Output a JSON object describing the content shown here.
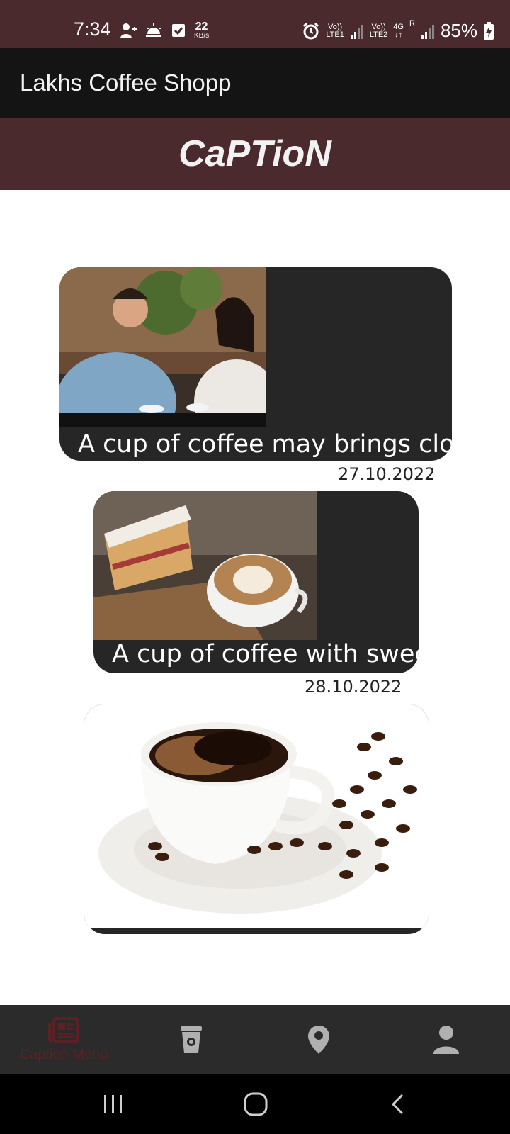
{
  "status_bar": {
    "time": "7:34",
    "net_speed_value": "22",
    "net_speed_unit": "KB/s",
    "sim1_label_top": "Vo))",
    "sim1_label_bottom": "LTE1",
    "sim2_label_top": "Vo))",
    "sim2_label_bottom": "LTE2",
    "network_type": "4G",
    "roaming": "R",
    "battery": "85%"
  },
  "app_bar": {
    "title": "Lakhs Coffee Shopp"
  },
  "header": {
    "title": "CaPTioN"
  },
  "posts": [
    {
      "caption": "A cup of coffee may brings closer",
      "date": "27.10.2022",
      "image": "couple-drinking-coffee-photo"
    },
    {
      "caption": "A cup of coffee with sweets",
      "date": "28.10.2022",
      "image": "cake-and-latte-photo"
    },
    {
      "caption": "",
      "date": "",
      "image": "coffee-cup-and-beans-photo"
    }
  ],
  "bottom_nav": {
    "items": [
      {
        "label": "Caption Menu",
        "icon": "newspaper-icon",
        "active": true
      },
      {
        "label": "",
        "icon": "coffee-cup-icon",
        "active": false
      },
      {
        "label": "",
        "icon": "location-pin-icon",
        "active": false
      },
      {
        "label": "",
        "icon": "person-icon",
        "active": false
      }
    ]
  },
  "colors": {
    "status_bar": "#4a2a2d",
    "app_bar": "#141414",
    "card": "#262626",
    "nav_bar": "#2b2b2b",
    "active_nav": "#5a2224",
    "inactive_icon": "#b0b0b0"
  }
}
